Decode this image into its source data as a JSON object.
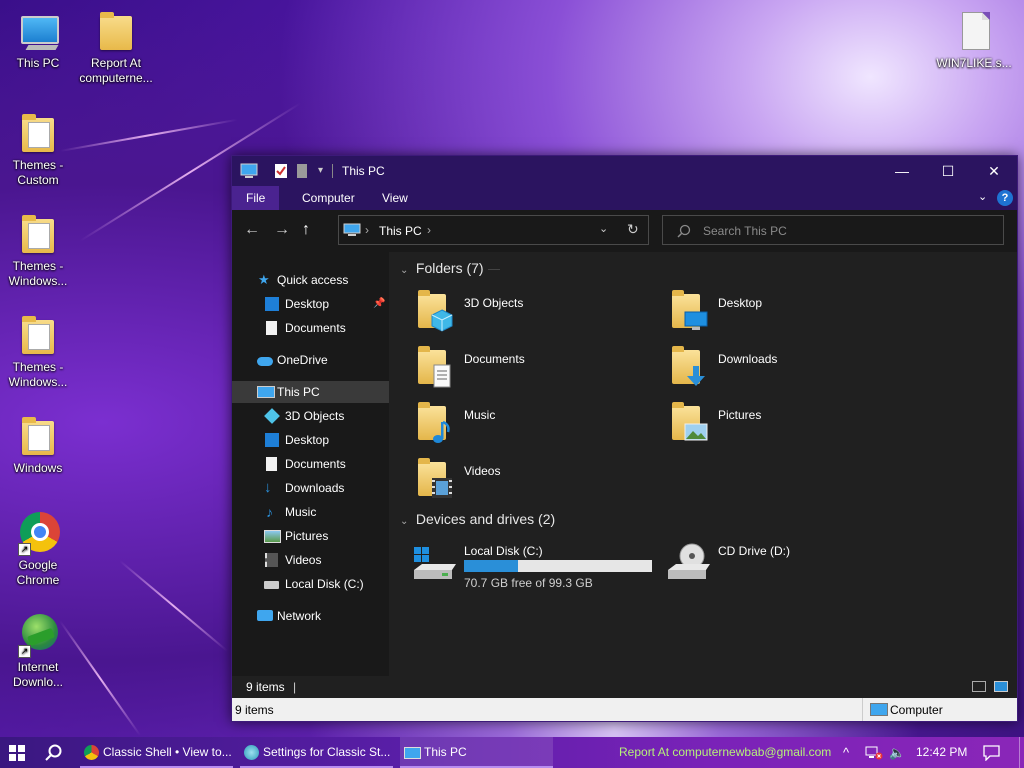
{
  "desktop": {
    "icons": [
      {
        "label": "This PC"
      },
      {
        "label": "Report At computerne..."
      },
      {
        "label": "WIN7LIKE.s..."
      },
      {
        "label": "Themes - Custom"
      },
      {
        "label": "Themes - Windows..."
      },
      {
        "label": "Themes - Windows..."
      },
      {
        "label": "Windows"
      },
      {
        "label": "Google Chrome"
      },
      {
        "label": "Internet Downlo..."
      }
    ]
  },
  "window": {
    "title": "This PC",
    "controls": {
      "minimize": "—",
      "maximize": "☐",
      "close": "✕"
    },
    "ribbon_tabs": [
      "File",
      "Computer",
      "View"
    ],
    "help": "?",
    "nav": {
      "back": "←",
      "forward": "→",
      "up": "↑"
    },
    "address": {
      "path": "This PC",
      "separator": "›"
    },
    "search": {
      "placeholder": "Search This PC"
    },
    "nav_pane": {
      "quick_access": "Quick access",
      "qa_items": [
        "Desktop",
        "Documents"
      ],
      "onedrive": "OneDrive",
      "this_pc": "This PC",
      "pc_items": [
        "3D Objects",
        "Desktop",
        "Documents",
        "Downloads",
        "Music",
        "Pictures",
        "Videos",
        "Local Disk (C:)"
      ],
      "network": "Network"
    },
    "folders_header": "Folders (7)",
    "folders": [
      "3D Objects",
      "Desktop",
      "Documents",
      "Downloads",
      "Music",
      "Pictures",
      "Videos"
    ],
    "devices_header": "Devices and drives (2)",
    "drives": [
      {
        "name": "Local Disk (C:)",
        "free": "70.7 GB free of 99.3 GB",
        "used_fraction": 0.288
      },
      {
        "name": "CD Drive (D:)"
      }
    ],
    "status_top": "9 items",
    "status_bottom_left": "9 items",
    "status_bottom_right": "Computer"
  },
  "taskbar": {
    "apps": [
      {
        "label": "Classic Shell • View to..."
      },
      {
        "label": "Settings for Classic St..."
      },
      {
        "label": "This PC"
      }
    ],
    "report": "Report At computernewbab@gmail.com",
    "clock": "12:42 PM"
  },
  "colors": {
    "accent": "#2b1460",
    "drive_bar": "#2a8fd8",
    "taskbar": "#5a1ea8"
  }
}
